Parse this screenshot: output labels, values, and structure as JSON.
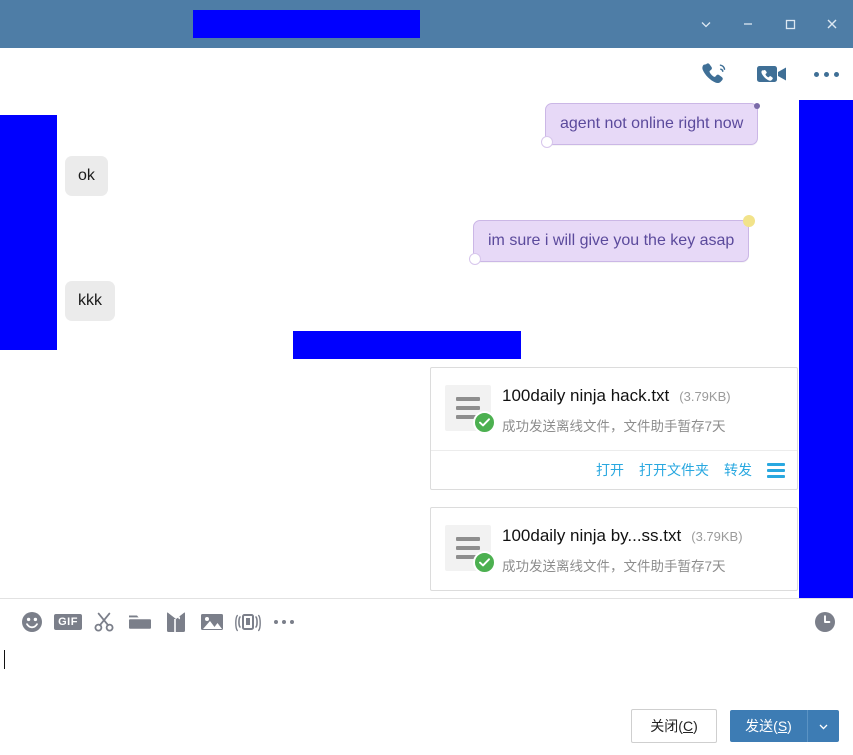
{
  "window": {
    "title_redacted": true,
    "controls": [
      {
        "name": "chevron-down-icon",
        "label": "∨"
      },
      {
        "name": "minimize-icon",
        "label": "–"
      },
      {
        "name": "maximize-icon",
        "label": "□"
      },
      {
        "name": "close-icon",
        "label": "✕"
      }
    ],
    "titlebar_color": "#4e7da6"
  },
  "chat_header": {
    "icons": [
      {
        "name": "voice-call-icon",
        "label": "voice-call"
      },
      {
        "name": "video-call-icon",
        "label": "video-call"
      },
      {
        "name": "more-options-icon",
        "label": "more-options"
      }
    ]
  },
  "messages": [
    {
      "id": "msg-0",
      "side": "outgoing",
      "text": "agent not online right now"
    },
    {
      "id": "msg-1",
      "side": "incoming",
      "text": "ok"
    },
    {
      "id": "msg-2",
      "side": "outgoing",
      "text": "im sure i will give you the key asap"
    },
    {
      "id": "msg-3",
      "side": "incoming",
      "text": "kkk"
    }
  ],
  "file_cards": [
    {
      "name": "100daily ninja hack.txt",
      "size": "(3.79KB)",
      "status": "成功发送离线文件，文件助手暂存7天",
      "actions": [
        {
          "name": "open-link",
          "label": "打开"
        },
        {
          "name": "open-folder-link",
          "label": "打开文件夹"
        },
        {
          "name": "forward-link",
          "label": "转发"
        }
      ],
      "has_actions": true
    },
    {
      "name": "100daily ninja by...ss.txt",
      "size": "(3.79KB)",
      "status": "成功发送离线文件，文件助手暂存7天",
      "actions": [],
      "has_actions": false
    }
  ],
  "composer": {
    "tools": [
      {
        "name": "emoji-icon",
        "label": "emoji"
      },
      {
        "name": "gif-icon",
        "label": "GIF"
      },
      {
        "name": "screenshot-scissors-icon",
        "label": "screenshot"
      },
      {
        "name": "folder-icon",
        "label": "send-file"
      },
      {
        "name": "red-packet-icon",
        "label": "red-packet"
      },
      {
        "name": "image-icon",
        "label": "image"
      },
      {
        "name": "shake-phone-icon",
        "label": "shake"
      },
      {
        "name": "more-tools-icon",
        "label": "more"
      }
    ],
    "history_icon": {
      "name": "chat-history-icon",
      "label": "history"
    },
    "input_value": "",
    "close_button": {
      "prefix": "关闭(",
      "key": "C",
      "suffix": ")"
    },
    "send_button": {
      "prefix": "发送(",
      "key": "S",
      "suffix": ")"
    },
    "send_caret": "∨"
  },
  "colors": {
    "titlebar": "#4e7da6",
    "accent_blue": "#3d7cb4",
    "link_blue": "#29a8e0",
    "outgoing_bubble": "#e7d9f7",
    "incoming_bubble": "#ebebeb",
    "redaction": "#0000ff",
    "check_green": "#4cb050"
  }
}
